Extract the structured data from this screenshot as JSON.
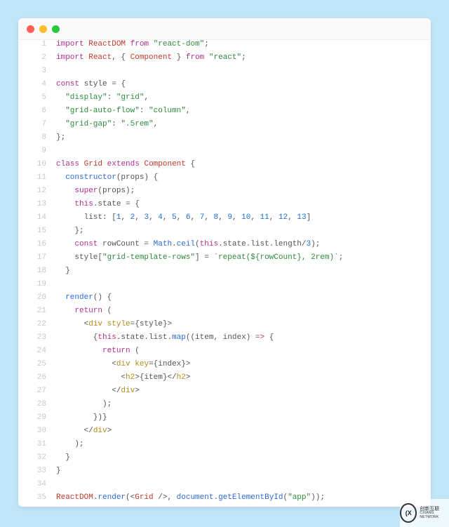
{
  "window": {
    "traffic_lights": [
      "red",
      "yellow",
      "green"
    ]
  },
  "watermark": {
    "ring": "(X",
    "line1": "创新互联",
    "line2": "CXIANG NETWORK"
  },
  "code_lines": [
    {
      "n": 1,
      "tokens": [
        [
          "kw",
          "import"
        ],
        [
          "",
          ""
        ],
        [
          "",
          " "
        ],
        [
          "def",
          "ReactDOM"
        ],
        [
          "",
          " "
        ],
        [
          "kw",
          "from"
        ],
        [
          "",
          " "
        ],
        [
          "str",
          "\"react-dom\""
        ],
        [
          "punc",
          ";"
        ]
      ]
    },
    {
      "n": 2,
      "tokens": [
        [
          "kw",
          "import"
        ],
        [
          "",
          " "
        ],
        [
          "def",
          "React"
        ],
        [
          "punc",
          ", { "
        ],
        [
          "def",
          "Component"
        ],
        [
          "punc",
          " } "
        ],
        [
          "kw",
          "from"
        ],
        [
          "",
          " "
        ],
        [
          "str",
          "\"react\""
        ],
        [
          "punc",
          ";"
        ]
      ]
    },
    {
      "n": 3,
      "tokens": [
        [
          "",
          " "
        ]
      ]
    },
    {
      "n": 4,
      "tokens": [
        [
          "kw",
          "const"
        ],
        [
          "",
          " "
        ],
        [
          "prop",
          "style"
        ],
        [
          "punc",
          " = {"
        ]
      ]
    },
    {
      "n": 5,
      "tokens": [
        [
          "",
          "  "
        ],
        [
          "str",
          "\"display\""
        ],
        [
          "punc",
          ": "
        ],
        [
          "str",
          "\"grid\""
        ],
        [
          "punc",
          ","
        ]
      ]
    },
    {
      "n": 6,
      "tokens": [
        [
          "",
          "  "
        ],
        [
          "str",
          "\"grid-auto-flow\""
        ],
        [
          "punc",
          ": "
        ],
        [
          "str",
          "\"column\""
        ],
        [
          "punc",
          ","
        ]
      ]
    },
    {
      "n": 7,
      "tokens": [
        [
          "",
          "  "
        ],
        [
          "str",
          "\"grid-gap\""
        ],
        [
          "punc",
          ": "
        ],
        [
          "str",
          "\".5rem\""
        ],
        [
          "punc",
          ","
        ]
      ]
    },
    {
      "n": 8,
      "tokens": [
        [
          "punc",
          "};"
        ]
      ]
    },
    {
      "n": 9,
      "tokens": [
        [
          "",
          " "
        ]
      ]
    },
    {
      "n": 10,
      "tokens": [
        [
          "kw",
          "class"
        ],
        [
          "",
          " "
        ],
        [
          "def",
          "Grid"
        ],
        [
          "",
          " "
        ],
        [
          "kw",
          "extends"
        ],
        [
          "",
          " "
        ],
        [
          "def",
          "Component"
        ],
        [
          "punc",
          " {"
        ]
      ]
    },
    {
      "n": 11,
      "tokens": [
        [
          "",
          "  "
        ],
        [
          "fn",
          "constructor"
        ],
        [
          "punc",
          "(props) {"
        ]
      ]
    },
    {
      "n": 12,
      "tokens": [
        [
          "",
          "    "
        ],
        [
          "kw",
          "super"
        ],
        [
          "punc",
          "(props);"
        ]
      ]
    },
    {
      "n": 13,
      "tokens": [
        [
          "",
          "    "
        ],
        [
          "kw",
          "this"
        ],
        [
          "punc",
          "."
        ],
        [
          "prop",
          "state"
        ],
        [
          "punc",
          " = {"
        ]
      ]
    },
    {
      "n": 14,
      "tokens": [
        [
          "",
          "      "
        ],
        [
          "prop",
          "list"
        ],
        [
          "punc",
          ": ["
        ],
        [
          "num",
          "1"
        ],
        [
          "punc",
          ", "
        ],
        [
          "num",
          "2"
        ],
        [
          "punc",
          ", "
        ],
        [
          "num",
          "3"
        ],
        [
          "punc",
          ", "
        ],
        [
          "num",
          "4"
        ],
        [
          "punc",
          ", "
        ],
        [
          "num",
          "5"
        ],
        [
          "punc",
          ", "
        ],
        [
          "num",
          "6"
        ],
        [
          "punc",
          ", "
        ],
        [
          "num",
          "7"
        ],
        [
          "punc",
          ", "
        ],
        [
          "num",
          "8"
        ],
        [
          "punc",
          ", "
        ],
        [
          "num",
          "9"
        ],
        [
          "punc",
          ", "
        ],
        [
          "num",
          "10"
        ],
        [
          "punc",
          ", "
        ],
        [
          "num",
          "11"
        ],
        [
          "punc",
          ", "
        ],
        [
          "num",
          "12"
        ],
        [
          "punc",
          ", "
        ],
        [
          "num",
          "13"
        ],
        [
          "punc",
          "]"
        ]
      ]
    },
    {
      "n": 15,
      "tokens": [
        [
          "",
          "    "
        ],
        [
          "punc",
          "};"
        ]
      ]
    },
    {
      "n": 16,
      "tokens": [
        [
          "",
          "    "
        ],
        [
          "kw",
          "const"
        ],
        [
          "punc",
          " rowCount = "
        ],
        [
          "builtin",
          "Math"
        ],
        [
          "punc",
          "."
        ],
        [
          "fn",
          "ceil"
        ],
        [
          "punc",
          "("
        ],
        [
          "kw",
          "this"
        ],
        [
          "punc",
          ".state.list.length/"
        ],
        [
          "num",
          "3"
        ],
        [
          "punc",
          ");"
        ]
      ]
    },
    {
      "n": 17,
      "tokens": [
        [
          "",
          "    style["
        ],
        [
          "str",
          "\"grid-template-rows\""
        ],
        [
          "punc",
          "] = "
        ],
        [
          "str",
          "`repeat(${rowCount}, 2rem)`"
        ],
        [
          "punc",
          ";"
        ]
      ]
    },
    {
      "n": 18,
      "tokens": [
        [
          "",
          "  "
        ],
        [
          "punc",
          "}"
        ]
      ]
    },
    {
      "n": 19,
      "tokens": [
        [
          "",
          " "
        ]
      ]
    },
    {
      "n": 20,
      "tokens": [
        [
          "",
          "  "
        ],
        [
          "fn",
          "render"
        ],
        [
          "punc",
          "() {"
        ]
      ]
    },
    {
      "n": 21,
      "tokens": [
        [
          "",
          "    "
        ],
        [
          "kw",
          "return"
        ],
        [
          "punc",
          " ("
        ]
      ]
    },
    {
      "n": 22,
      "tokens": [
        [
          "",
          "      <"
        ],
        [
          "jsx",
          "div"
        ],
        [
          "",
          " "
        ],
        [
          "attr",
          "style"
        ],
        [
          "punc",
          "="
        ],
        [
          "punc",
          "{style}>"
        ]
      ]
    },
    {
      "n": 23,
      "tokens": [
        [
          "",
          "        {"
        ],
        [
          "kw",
          "this"
        ],
        [
          "punc",
          ".state.list."
        ],
        [
          "fn",
          "map"
        ],
        [
          "punc",
          "((item, index) "
        ],
        [
          "kw",
          "=>"
        ],
        [
          "punc",
          " {"
        ]
      ]
    },
    {
      "n": 24,
      "tokens": [
        [
          "",
          "          "
        ],
        [
          "kw",
          "return"
        ],
        [
          "punc",
          " ("
        ]
      ]
    },
    {
      "n": 25,
      "tokens": [
        [
          "",
          "            <"
        ],
        [
          "jsx",
          "div"
        ],
        [
          "",
          " "
        ],
        [
          "attr",
          "key"
        ],
        [
          "punc",
          "={index}>"
        ]
      ]
    },
    {
      "n": 26,
      "tokens": [
        [
          "",
          "              <"
        ],
        [
          "jsx",
          "h2"
        ],
        [
          "punc",
          ">"
        ],
        [
          "punc",
          "{item}"
        ],
        [
          "punc",
          "</"
        ],
        [
          "jsx",
          "h2"
        ],
        [
          "punc",
          ">"
        ]
      ]
    },
    {
      "n": 27,
      "tokens": [
        [
          "",
          "            </"
        ],
        [
          "jsx",
          "div"
        ],
        [
          "punc",
          ">"
        ]
      ]
    },
    {
      "n": 28,
      "tokens": [
        [
          "",
          "          );"
        ]
      ]
    },
    {
      "n": 29,
      "tokens": [
        [
          "",
          "        })}"
        ]
      ]
    },
    {
      "n": 30,
      "tokens": [
        [
          "",
          "      </"
        ],
        [
          "jsx",
          "div"
        ],
        [
          "punc",
          ">"
        ]
      ]
    },
    {
      "n": 31,
      "tokens": [
        [
          "",
          "    );"
        ]
      ]
    },
    {
      "n": 32,
      "tokens": [
        [
          "",
          "  }"
        ]
      ]
    },
    {
      "n": 33,
      "tokens": [
        [
          "punc",
          "}"
        ]
      ]
    },
    {
      "n": 34,
      "tokens": [
        [
          "",
          " "
        ]
      ]
    },
    {
      "n": 35,
      "tokens": [
        [
          "def",
          "ReactDOM"
        ],
        [
          "punc",
          "."
        ],
        [
          "fn",
          "render"
        ],
        [
          "punc",
          "(<"
        ],
        [
          "def",
          "Grid"
        ],
        [
          "punc",
          " />, "
        ],
        [
          "builtin",
          "document"
        ],
        [
          "punc",
          "."
        ],
        [
          "fn",
          "getElementById"
        ],
        [
          "punc",
          "("
        ],
        [
          "str",
          "\"app\""
        ],
        [
          "punc",
          "));"
        ]
      ]
    }
  ]
}
